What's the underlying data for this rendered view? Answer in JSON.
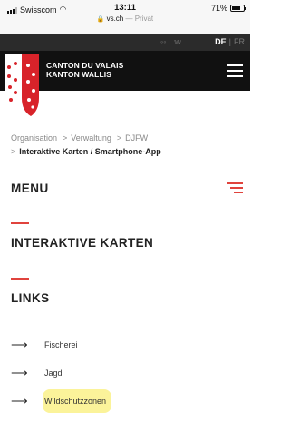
{
  "status_bar": {
    "carrier": "Swisscom",
    "time": "13:11",
    "url": "vs.ch",
    "private_label": "— Privat",
    "battery": "71%",
    "battery_level": 0.71
  },
  "header": {
    "lang_active": "DE",
    "lang_separator": "|",
    "lang_other": "FR",
    "brand_line1": "CANTON DU VALAIS",
    "brand_line2": "KANTON WALLIS",
    "share_icon": "share-icon",
    "twitter_icon": "twitter-icon"
  },
  "breadcrumb": {
    "items": [
      "Organisation",
      "Verwaltung",
      "DJFW"
    ],
    "current": "Interaktive Karten / Smartphone-App",
    "separator": ">"
  },
  "menu": {
    "label": "MENU"
  },
  "sections": {
    "interactive_maps": "INTERAKTIVE KARTEN",
    "links_title": "LINKS"
  },
  "links": [
    {
      "arrow": "⟶",
      "label": "Fischerei"
    },
    {
      "arrow": "⟶",
      "label": "Jagd"
    },
    {
      "arrow": "⟶",
      "label": "Wildschutzzonen",
      "highlighted": true
    }
  ],
  "colors": {
    "accent_red": "#e0433d",
    "highlight_yellow": "#fbf39a",
    "header_dark": "#111111"
  }
}
